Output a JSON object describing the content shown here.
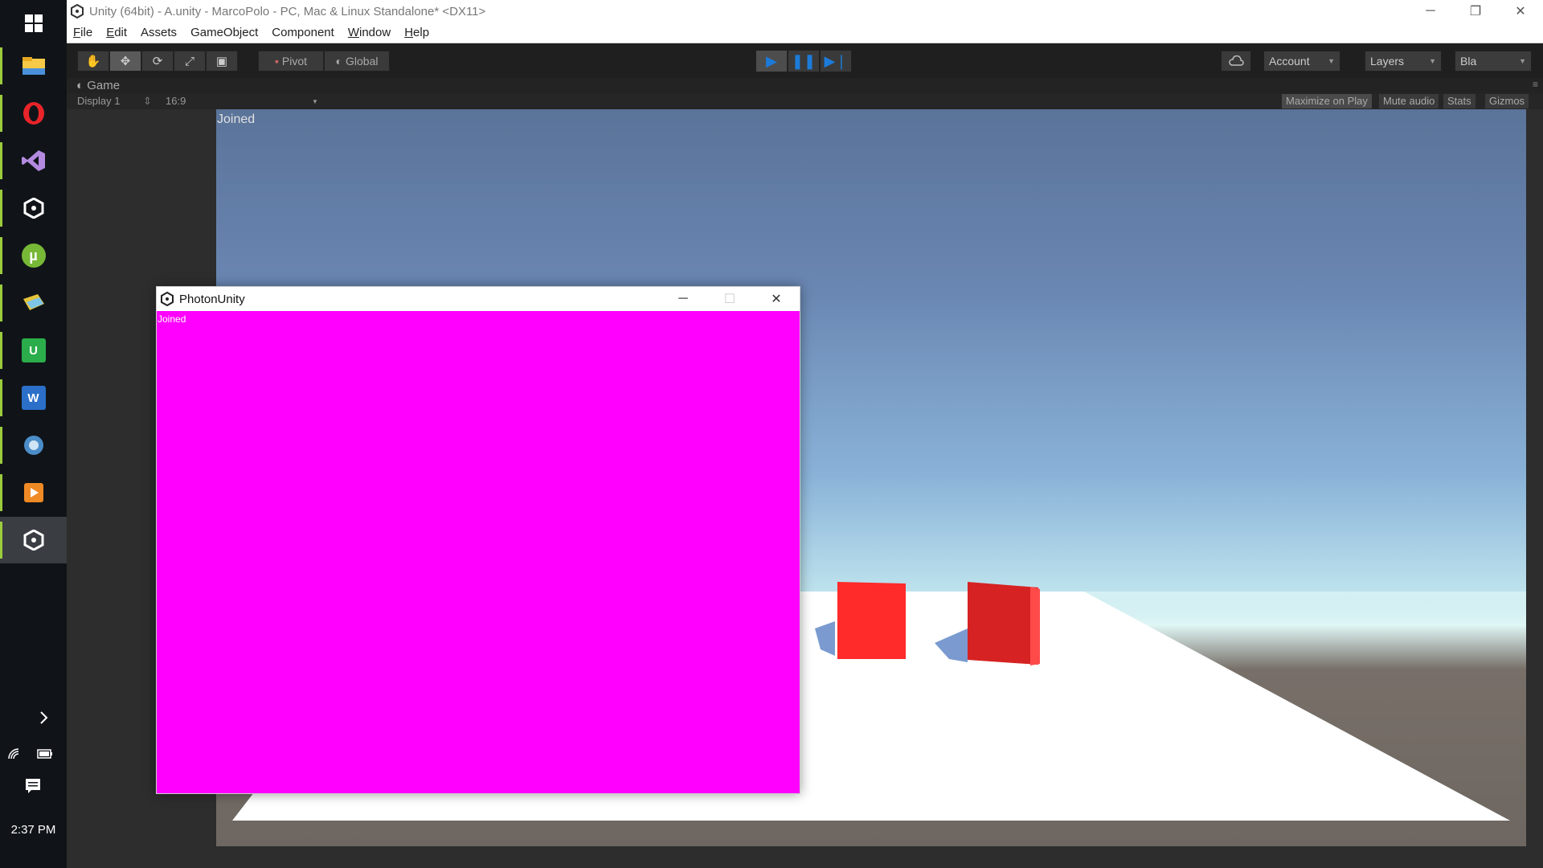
{
  "taskbar": {
    "clock": "2:37 PM",
    "icons": [
      {
        "name": "windows-start-icon",
        "color": "#ffffff"
      },
      {
        "name": "file-explorer-icon",
        "color": "#f7c948"
      },
      {
        "name": "opera-icon",
        "color": "#e8242a"
      },
      {
        "name": "visual-studio-icon",
        "color": "#9b63c9"
      },
      {
        "name": "unity-icon",
        "color": "#ffffff"
      },
      {
        "name": "utorrent-icon",
        "color": "#77b837"
      },
      {
        "name": "notes-icon",
        "color": "#e5c33a"
      },
      {
        "name": "upwork-icon",
        "color": "#2bad4b"
      },
      {
        "name": "word-icon",
        "color": "#2b6fc8"
      },
      {
        "name": "browser-icon",
        "color": "#4b8dc8"
      },
      {
        "name": "media-player-icon",
        "color": "#f08a24"
      },
      {
        "name": "unity-active-icon",
        "color": "#ffffff"
      }
    ]
  },
  "window": {
    "title": "Unity (64bit) - A.unity - MarcoPolo - PC, Mac & Linux Standalone* <DX11>",
    "minimize": "─",
    "restore": "❐",
    "close": "✕"
  },
  "menu": [
    {
      "u": "F",
      "rest": "ile"
    },
    {
      "u": "E",
      "rest": "dit"
    },
    {
      "u": "",
      "rest": "Assets"
    },
    {
      "u": "",
      "rest": "GameObject"
    },
    {
      "u": "",
      "rest": "Component"
    },
    {
      "u": "W",
      "rest": "indow"
    },
    {
      "u": "H",
      "rest": "elp"
    }
  ],
  "toolbar": {
    "pivot": "Pivot",
    "global": "Global",
    "account": "Account",
    "layers": "Layers",
    "layout": "Bla"
  },
  "game": {
    "tab_label": "Game",
    "display": "Display 1",
    "aspect": "16:9",
    "maximize_on_play": "Maximize on Play",
    "mute_audio": "Mute audio",
    "stats": "Stats",
    "gizmos": "Gizmos",
    "status_text": "Joined"
  },
  "photon_window": {
    "title": "PhotonUnity",
    "status_text": "Joined",
    "content_color": "#ff00ff"
  }
}
